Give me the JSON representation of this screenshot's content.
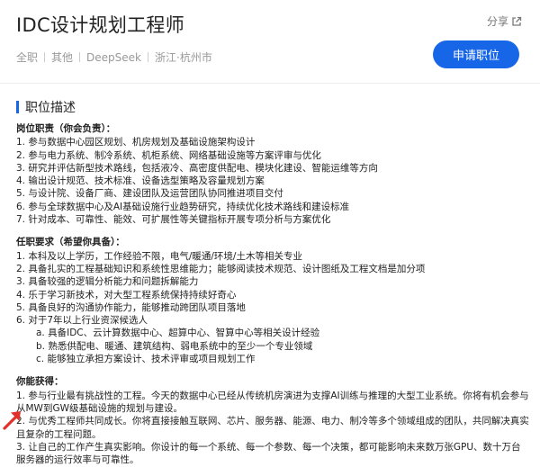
{
  "header": {
    "title": "IDC设计规划工程师",
    "share_label": "分享",
    "tags": [
      "全职",
      "其他",
      "DeepSeek",
      "浙江·杭州市"
    ],
    "apply_label": "申请职位"
  },
  "section": {
    "title": "职位描述"
  },
  "responsibilities": {
    "title": "岗位职责（你会负责）：",
    "items": [
      "1. 参与数据中心园区规划、机房规划及基础设施架构设计",
      "2. 参与电力系统、制冷系统、机柜系统、网络基础设施等方案评审与优化",
      "3. 研究并评估新型技术路线，包括液冷、高密度供配电、模块化建设、智能运维等方向",
      "4. 输出设计规范、技术标准、设备选型策略及容量规划方案",
      "5. 与设计院、设备厂商、建设团队及运营团队协同推进项目交付",
      "6. 参与全球数据中心及AI基础设施行业趋势研究，持续优化技术路线和建设标准",
      "7. 针对成本、可靠性、能效、可扩展性等关键指标开展专项分析与方案优化"
    ]
  },
  "requirements": {
    "title": "任职要求（希望你具备）：",
    "items": [
      "1. 本科及以上学历，工作经验不限，电气/暖通/环境/土木等相关专业",
      "2. 具备扎实的工程基础知识和系统性思维能力；能够阅读技术规范、设计图纸及工程文档是加分项",
      "3. 具备较强的逻辑分析能力和问题拆解能力",
      "4. 乐于学习新技术，对大型工程系统保持持续好奇心",
      "5. 具备良好的沟通协作能力，能够推动跨团队项目落地",
      "6. 对于7年以上行业资深候选人"
    ],
    "sub_items": [
      "a. 具备IDC、云计算数据中心、超算中心、智算中心等相关设计经验",
      "b. 熟悉供配电、暖通、建筑结构、弱电系统中的至少一个专业领域",
      "c. 能够独立承担方案设计、技术评审或项目规划工作"
    ]
  },
  "benefits": {
    "title": "你能获得：",
    "items": [
      "1. 参与行业最有挑战性的工程。今天的数据中心已经从传统机房演进为支撑AI训练与推理的大型工业系统。你将有机会参与从MW到GW级基础设施的规划与建设。",
      "2. 与优秀工程师共同成长。你将直接接触互联网、芯片、服务器、能源、电力、制冷等多个领域组成的团队，共同解决真实且复杂的工程问题。",
      "3. 让自己的工作产生真实影响。你设计的每一个系统、每一个参数、每一个决策，都可能影响未来数万张GPU、数十万台服务器的运行效率与可靠性。"
    ]
  },
  "colors": {
    "accent": "#1766e8",
    "arrow": "#e0322b",
    "text": "#222222",
    "muted": "#999999"
  }
}
